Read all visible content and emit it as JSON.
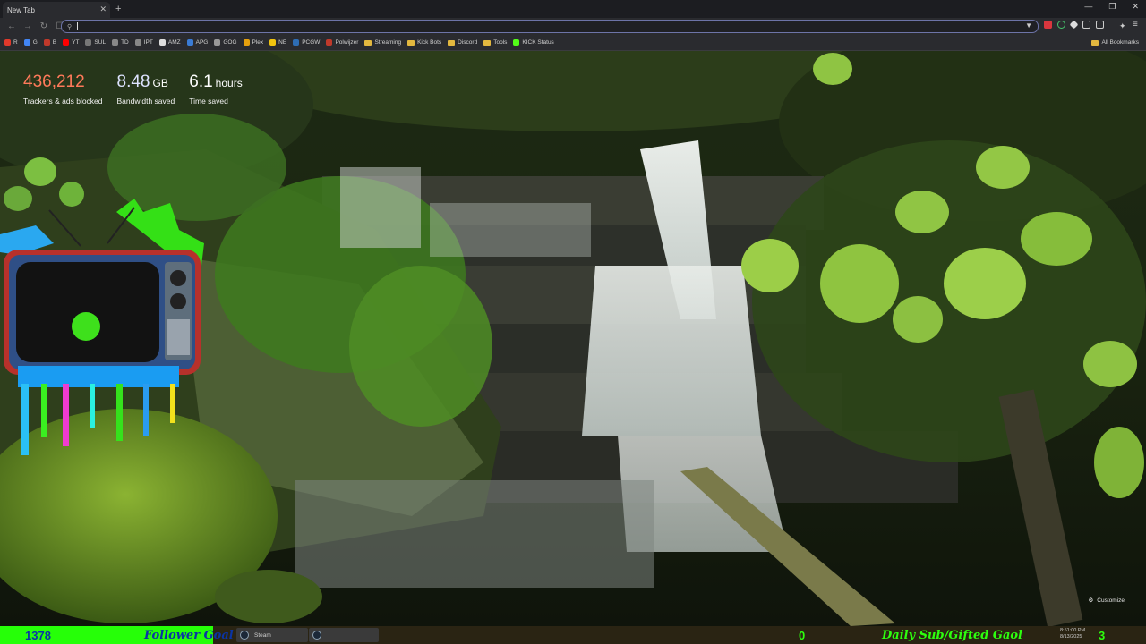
{
  "browser": {
    "tab": {
      "title": "New Tab",
      "close": "✕"
    },
    "new_tab": "+",
    "window_controls": [
      "—",
      "❐",
      "✕"
    ],
    "nav": {
      "back": "←",
      "forward": "→",
      "reload": "↻",
      "bookmark": "☐"
    },
    "address": {
      "value": "",
      "placeholder": ""
    },
    "bookmarks": [
      {
        "label": "R",
        "icon": "bookmark-icon",
        "color": "#e0392b"
      },
      {
        "label": "G",
        "icon": "bookmark-icon",
        "color": "#4285f4"
      },
      {
        "label": "B",
        "icon": "bookmark-icon",
        "color": "#c0392b"
      },
      {
        "label": "YT",
        "icon": "youtube-icon",
        "color": "#ff0000"
      },
      {
        "label": "SUL",
        "icon": "bookmark-icon",
        "color": "#777777"
      },
      {
        "label": "TD",
        "icon": "bookmark-icon",
        "color": "#888888"
      },
      {
        "label": "IPT",
        "icon": "bookmark-icon",
        "color": "#888888"
      },
      {
        "label": "AMZ",
        "icon": "bookmark-icon",
        "color": "#dddddd"
      },
      {
        "label": "APG",
        "icon": "bookmark-icon",
        "color": "#3a7bd5"
      },
      {
        "label": "GOG",
        "icon": "bookmark-icon",
        "color": "#999999"
      },
      {
        "label": "Plex",
        "icon": "bookmark-icon",
        "color": "#e5a00d"
      },
      {
        "label": "NE",
        "icon": "bookmark-icon",
        "color": "#f1c40f"
      },
      {
        "label": "PCGW",
        "icon": "bookmark-icon",
        "color": "#2e6db4"
      },
      {
        "label": "Polwijzer",
        "icon": "bookmark-icon",
        "color": "#c0392b"
      },
      {
        "label": "Streaming",
        "icon": "folder-icon",
        "color": "#e3b83f"
      },
      {
        "label": "Kick Bots",
        "icon": "folder-icon",
        "color": "#e3b83f"
      },
      {
        "label": "Discord",
        "icon": "folder-icon",
        "color": "#e3b83f"
      },
      {
        "label": "Tools",
        "icon": "folder-icon",
        "color": "#e3b83f"
      },
      {
        "label": "KICK Status",
        "icon": "bookmark-icon",
        "color": "#53fc18"
      }
    ],
    "all_bookmarks": "All Bookmarks"
  },
  "stats": [
    {
      "value": "436,212",
      "unit": "",
      "label": "Trackers & ads blocked",
      "color": "#ff7a5a"
    },
    {
      "value": "8.48",
      "unit": "GB",
      "label": "Bandwidth saved",
      "color": "#dde3ff"
    },
    {
      "value": "6.1",
      "unit": "hours",
      "label": "Time saved",
      "color": "#ffffff"
    }
  ],
  "customize": "Customize",
  "taskbar": {
    "follower_count": "1378",
    "follower_label": "Follower Goal",
    "apps": [
      "Steam",
      ""
    ],
    "goal_current": "0",
    "goal_label": "Daily Sub/Gifted Gaol",
    "time": "8:51:00 PM",
    "date": "8/13/2025",
    "goal_target": "3"
  }
}
